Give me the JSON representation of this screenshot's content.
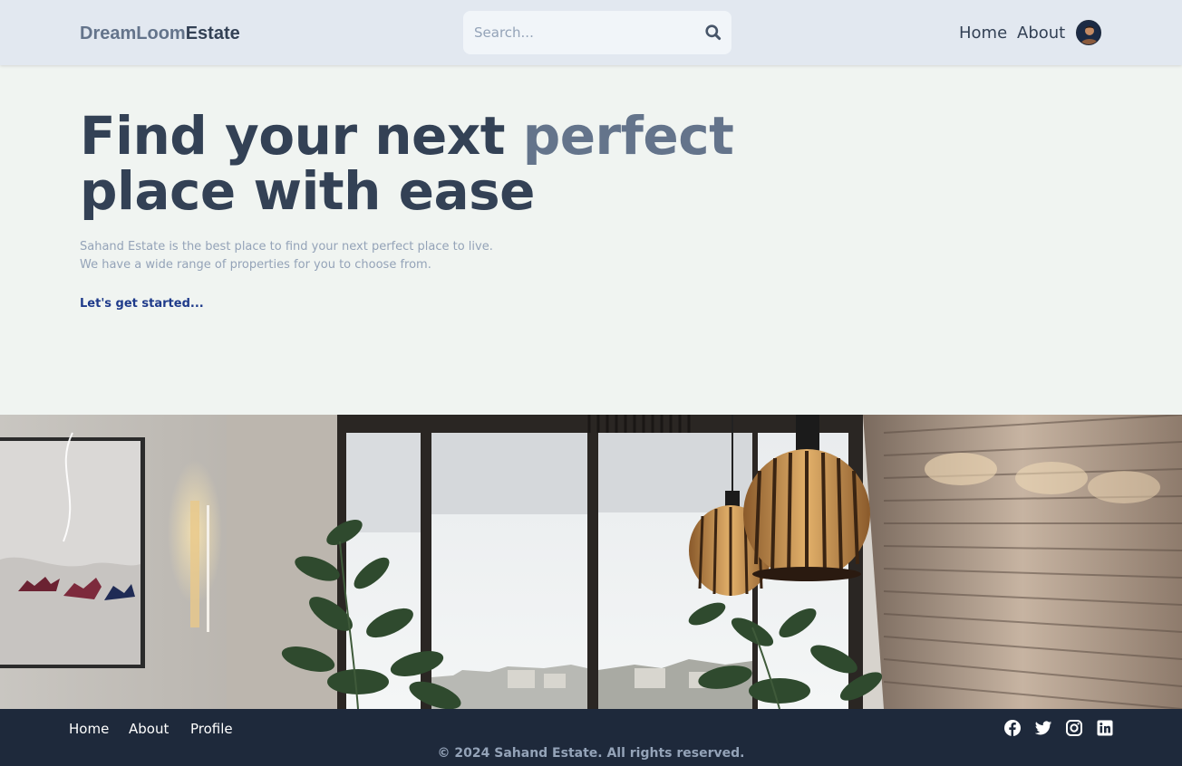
{
  "header": {
    "logo_part1": "DreamLoom",
    "logo_part2": "Estate",
    "search_placeholder": "Search...",
    "nav": {
      "home": "Home",
      "about": "About"
    }
  },
  "hero": {
    "title_part1": "Find your next ",
    "title_accent": "perfect",
    "title_part2": "place with ease",
    "desc_line1": "Sahand Estate is the best place to find your next perfect place to live.",
    "desc_line2": "We have a wide range of properties for you to choose from.",
    "cta": "Let's get started..."
  },
  "footer": {
    "links": {
      "home": "Home",
      "about": "About",
      "profile": "Profile"
    },
    "social": [
      "facebook-icon",
      "twitter-icon",
      "instagram-icon",
      "linkedin-icon"
    ],
    "copyright": "© 2024 Sahand Estate. All rights reserved."
  },
  "colors": {
    "header_bg": "#e2e8f0",
    "page_bg": "#f0f4f1",
    "text_dark": "#334155",
    "text_muted": "#64748b",
    "cta": "#1e3a8a",
    "footer_bg": "#1e293b"
  }
}
